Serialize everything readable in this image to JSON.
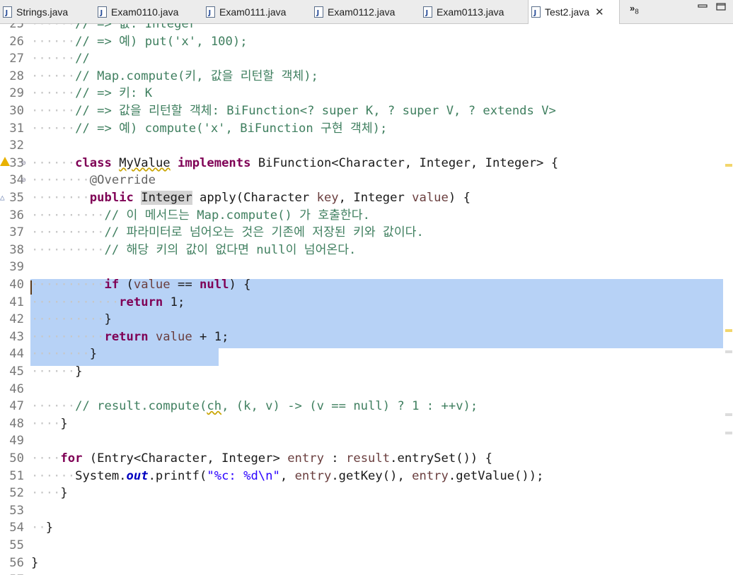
{
  "tabs": [
    {
      "label": "Strings.java",
      "active": false
    },
    {
      "label": "Exam0110.java",
      "active": false
    },
    {
      "label": "Exam0111.java",
      "active": false
    },
    {
      "label": "Exam0112.java",
      "active": false
    },
    {
      "label": "Exam0113.java",
      "active": false
    },
    {
      "label": "Test2.java",
      "active": true
    }
  ],
  "overflow": {
    "glyph": "»",
    "count": "8"
  },
  "colors": {
    "comment": "#3f7f5f",
    "keyword": "#7f0055",
    "annotation": "#646464",
    "variable": "#6a3e3e",
    "string": "#2a00ff",
    "field": "#0000c0",
    "selection": "#b7d2f6",
    "line_number": "#787878"
  },
  "editor": {
    "lines": [
      {
        "num": "25",
        "ws": "······",
        "segs": [
          {
            "t": "c",
            "x": "// => 값: Integer"
          }
        ]
      },
      {
        "num": "26",
        "ws": "······",
        "segs": [
          {
            "t": "c",
            "x": "// => 예) put('x', 100);"
          }
        ]
      },
      {
        "num": "27",
        "ws": "······",
        "segs": [
          {
            "t": "c",
            "x": "//"
          }
        ]
      },
      {
        "num": "28",
        "ws": "······",
        "segs": [
          {
            "t": "c",
            "x": "// Map.compute(키, 값을 리턴할 객체);"
          }
        ]
      },
      {
        "num": "29",
        "ws": "······",
        "segs": [
          {
            "t": "c",
            "x": "// => 키: K"
          }
        ]
      },
      {
        "num": "30",
        "ws": "······",
        "segs": [
          {
            "t": "c",
            "x": "// => 값을 리턴할 객체: BiFunction<? super K, ? super V, ? extends V>"
          }
        ]
      },
      {
        "num": "31",
        "ws": "······",
        "segs": [
          {
            "t": "c",
            "x": "// => 예) compute('x', BiFunction 구현 객체);"
          }
        ]
      },
      {
        "num": "32",
        "ws": "",
        "segs": []
      },
      {
        "num": "33",
        "ws": "······",
        "warn": true,
        "fold": "⊖",
        "segs": [
          {
            "t": "k",
            "x": "class"
          },
          {
            "t": "",
            "x": " "
          },
          {
            "t": "w",
            "x": "MyValue"
          },
          {
            "t": "",
            "x": " "
          },
          {
            "t": "k",
            "x": "implements"
          },
          {
            "t": "",
            "x": " BiFunction<Character, Integer, Integer> {"
          }
        ]
      },
      {
        "num": "34",
        "ws": "········",
        "fold": "⊖",
        "segs": [
          {
            "t": "a",
            "x": "@Override"
          }
        ]
      },
      {
        "num": "35",
        "ws": "········",
        "marker": "△",
        "segs": [
          {
            "t": "k",
            "x": "public"
          },
          {
            "t": "",
            "x": " "
          },
          {
            "t": "h",
            "x": "Integer"
          },
          {
            "t": "",
            "x": " apply(Character "
          },
          {
            "t": "v",
            "x": "key"
          },
          {
            "t": "",
            "x": ", Integer "
          },
          {
            "t": "v",
            "x": "value"
          },
          {
            "t": "",
            "x": ") {"
          }
        ]
      },
      {
        "num": "36",
        "ws": "··········",
        "segs": [
          {
            "t": "c",
            "x": "// 이 메서드는 Map.compute() 가 호출한다."
          }
        ]
      },
      {
        "num": "37",
        "ws": "··········",
        "segs": [
          {
            "t": "c",
            "x": "// 파라미터로 넘어오는 것은 기존에 저장된 키와 값이다."
          }
        ]
      },
      {
        "num": "38",
        "ws": "··········",
        "segs": [
          {
            "t": "c",
            "x": "// 해당 키의 값이 없다면 null이 넘어온다."
          }
        ]
      },
      {
        "num": "39",
        "ws": "",
        "segs": []
      },
      {
        "num": "40",
        "ws": "··········",
        "segs": [
          {
            "t": "k",
            "x": "if"
          },
          {
            "t": "",
            "x": " ("
          },
          {
            "t": "v",
            "x": "value"
          },
          {
            "t": "",
            "x": " == "
          },
          {
            "t": "k",
            "x": "null"
          },
          {
            "t": "",
            "x": ") {"
          }
        ]
      },
      {
        "num": "41",
        "ws": "············",
        "segs": [
          {
            "t": "k",
            "x": "return"
          },
          {
            "t": "",
            "x": " 1;"
          }
        ]
      },
      {
        "num": "42",
        "ws": "··········",
        "segs": [
          {
            "t": "",
            "x": "}"
          }
        ]
      },
      {
        "num": "43",
        "ws": "··········",
        "segs": [
          {
            "t": "k",
            "x": "return"
          },
          {
            "t": "",
            "x": " "
          },
          {
            "t": "v",
            "x": "value"
          },
          {
            "t": "",
            "x": " + 1;"
          }
        ]
      },
      {
        "num": "44",
        "ws": "········",
        "segs": [
          {
            "t": "",
            "x": "}"
          }
        ]
      },
      {
        "num": "45",
        "ws": "······",
        "segs": [
          {
            "t": "",
            "x": "}"
          }
        ]
      },
      {
        "num": "46",
        "ws": "",
        "segs": []
      },
      {
        "num": "47",
        "ws": "······",
        "segs": [
          {
            "t": "c",
            "x": "// result.compute("
          },
          {
            "t": "cw",
            "x": "ch"
          },
          {
            "t": "c",
            "x": ", (k, v) -> (v == null) ? 1 : ++v);"
          }
        ]
      },
      {
        "num": "48",
        "ws": "····",
        "segs": [
          {
            "t": "",
            "x": "}"
          }
        ]
      },
      {
        "num": "49",
        "ws": "",
        "segs": []
      },
      {
        "num": "50",
        "ws": "····",
        "segs": [
          {
            "t": "k",
            "x": "for"
          },
          {
            "t": "",
            "x": " (Entry<Character, Integer> "
          },
          {
            "t": "v",
            "x": "entry"
          },
          {
            "t": "",
            "x": " : "
          },
          {
            "t": "v",
            "x": "result"
          },
          {
            "t": "",
            "x": ".entrySet()) {"
          }
        ]
      },
      {
        "num": "51",
        "ws": "······",
        "segs": [
          {
            "t": "",
            "x": "System."
          },
          {
            "t": "f",
            "x": "out"
          },
          {
            "t": "",
            "x": ".printf("
          },
          {
            "t": "s",
            "x": "\"%c: %d\\n\""
          },
          {
            "t": "",
            "x": ", "
          },
          {
            "t": "v",
            "x": "entry"
          },
          {
            "t": "",
            "x": ".getKey(), "
          },
          {
            "t": "v",
            "x": "entry"
          },
          {
            "t": "",
            "x": ".getValue());"
          }
        ]
      },
      {
        "num": "52",
        "ws": "····",
        "segs": [
          {
            "t": "",
            "x": "}"
          }
        ]
      },
      {
        "num": "53",
        "ws": "",
        "segs": []
      },
      {
        "num": "54",
        "ws": "··",
        "segs": [
          {
            "t": "",
            "x": "}"
          }
        ]
      },
      {
        "num": "55",
        "ws": "",
        "segs": []
      },
      {
        "num": "56",
        "ws": "",
        "segs": [
          {
            "t": "",
            "x": "}"
          }
        ]
      },
      {
        "num": "57",
        "ws": "",
        "segs": []
      }
    ]
  }
}
